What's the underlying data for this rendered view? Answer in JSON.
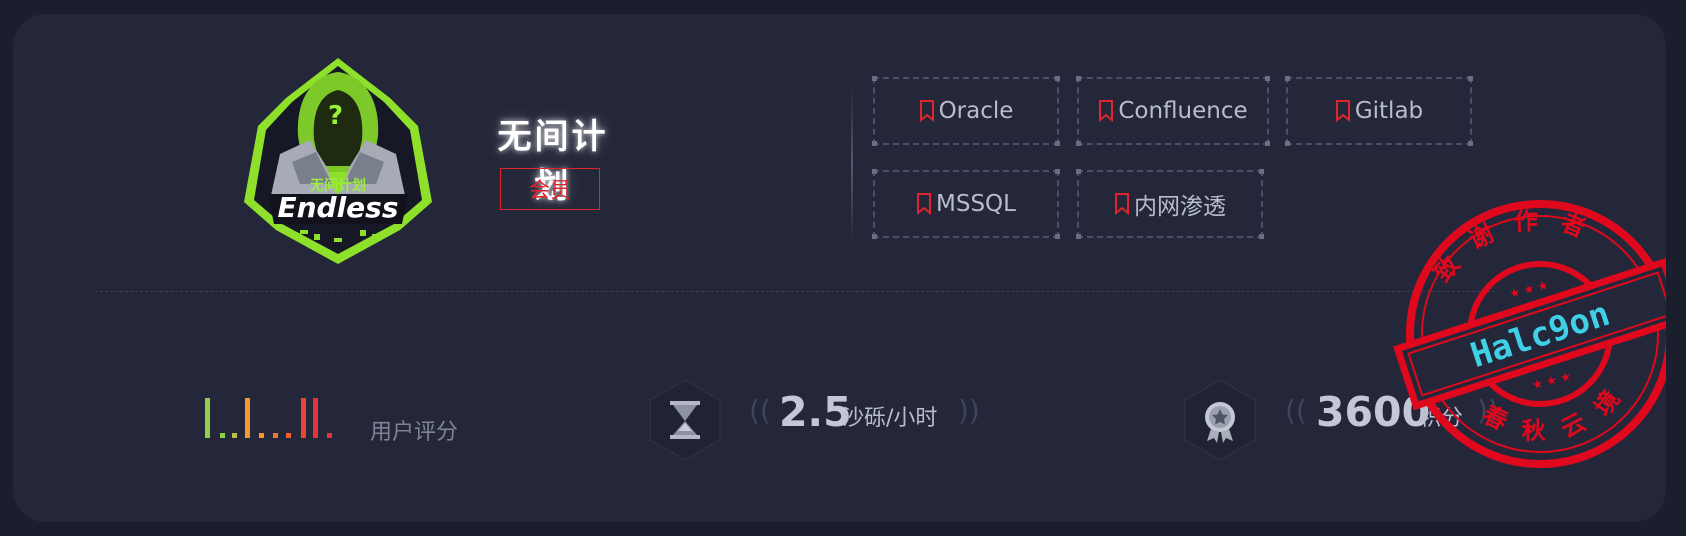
{
  "profile": {
    "title": "无间计划",
    "badge": "会员",
    "logo_text_cn": "无间计划",
    "logo_text_en": "Endless"
  },
  "tags": [
    {
      "label": "Oracle"
    },
    {
      "label": "Confluence"
    },
    {
      "label": "Gitlab"
    },
    {
      "label": "MSSQL"
    },
    {
      "label": "内网渗透"
    }
  ],
  "stats": {
    "rating_label": "用户评分",
    "rating_colors": [
      "#8fd14a",
      "#f29a2b",
      "#f1602e",
      "#e6323a"
    ],
    "time": {
      "value": "2.5",
      "unit": "沙砾/小时"
    },
    "points": {
      "value": "3600",
      "unit": "积分"
    }
  },
  "stamp": {
    "top_text": "致谢作者",
    "bottom_text": "春秋云境",
    "name": "Halc9on",
    "color": "#e0081c"
  },
  "colors": {
    "background": "#1b1e2c",
    "card": "#232739",
    "accent_red": "#e0242e"
  }
}
